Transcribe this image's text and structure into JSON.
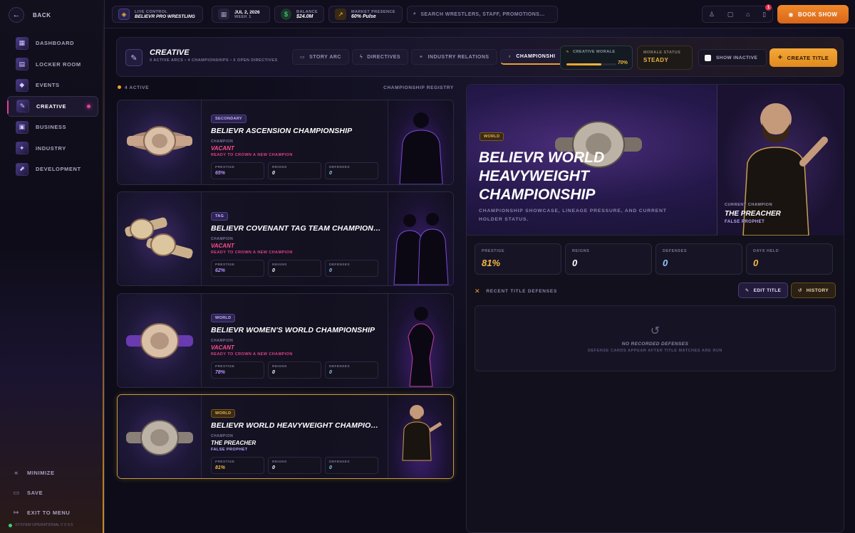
{
  "nav": {
    "back_label": "BACK",
    "items": [
      {
        "label": "DASHBOARD",
        "icon": "dashboard-icon",
        "active": false
      },
      {
        "label": "LOCKER ROOM",
        "icon": "locker-room-icon",
        "active": false
      },
      {
        "label": "EVENTS",
        "icon": "events-icon",
        "active": false
      },
      {
        "label": "CREATIVE",
        "icon": "creative-icon",
        "active": true
      },
      {
        "label": "BUSINESS",
        "icon": "business-icon",
        "active": false
      },
      {
        "label": "INDUSTRY",
        "icon": "industry-icon",
        "active": false
      },
      {
        "label": "DEVELOPMENT",
        "icon": "development-icon",
        "active": false
      }
    ],
    "minimize_label": "MINIMIZE",
    "save_label": "SAVE",
    "exit_label": "EXIT TO MENU",
    "status_label": "SYSTEM OPERATIONAL // V 0.5"
  },
  "topbar": {
    "live_label": "LIVE CONTROL",
    "promotion": "BELIEVR PRO WRESTLING",
    "date": "JUL 2, 2026",
    "week": "WEEK 1",
    "balance_label": "BALANCE",
    "balance": "$24.0M",
    "presence_label": "MARKET PRESENCE",
    "presence": "60% Pulse",
    "search_placeholder": "SEARCH WRESTLERS, STAFF, PROMOTIONS...",
    "notification_count": "1",
    "book_show_label": "BOOK SHOW"
  },
  "header": {
    "title": "CREATIVE",
    "subtitle": "0 ACTIVE ARCS • 4 CHAMPIONSHIPS • 0 OPEN DIRECTIVES",
    "tabs": [
      {
        "label": "STORY ARC",
        "icon": "book-icon"
      },
      {
        "label": "DIRECTIVES",
        "icon": "bolt-icon"
      },
      {
        "label": "INDUSTRY RELATIONS",
        "icon": "handshake-icon"
      },
      {
        "label": "CHAMPIONSHI",
        "icon": "medal-icon"
      }
    ],
    "morale_label": "CREATIVE MORALE",
    "morale_value": "70%",
    "morale_fraction": 0.7,
    "status_label": "MORALE STATUS",
    "status_value": "STEADY",
    "show_inactive_label": "SHOW INACTIVE",
    "create_label": "CREATE TITLE"
  },
  "list": {
    "count_label": "4 ACTIVE",
    "registry_label": "CHAMPIONSHIP REGISTRY",
    "champion_label": "CHAMPION",
    "prestige_label": "PRESTIGE",
    "reigns_label": "REIGNS",
    "defenses_label": "DEFENSES"
  },
  "cards": [
    {
      "tag": "SECONDARY",
      "tag_style": "purple",
      "name": "BELIEVR ASCENSION CHAMPIONSHIP",
      "champion": "VACANT",
      "sub": "READY TO CROWN A NEW CHAMPION",
      "vacant": true,
      "prestige": "65%",
      "reigns": "0",
      "defenses": "0",
      "selected": false
    },
    {
      "tag": "TAG",
      "tag_style": "purple",
      "name": "BELIEVR COVENANT TAG TEAM CHAMPIONS...",
      "champion": "VACANT",
      "sub": "READY TO CROWN A NEW CHAMPION",
      "vacant": true,
      "prestige": "62%",
      "reigns": "0",
      "defenses": "0",
      "selected": false
    },
    {
      "tag": "WORLD",
      "tag_style": "purple",
      "name": "BELIEVR WOMEN'S WORLD CHAMPIONSHIP",
      "champion": "VACANT",
      "sub": "READY TO CROWN A NEW CHAMPION",
      "vacant": true,
      "prestige": "78%",
      "reigns": "0",
      "defenses": "0",
      "selected": false
    },
    {
      "tag": "WORLD",
      "tag_style": "gold",
      "name": "BELIEVR WORLD HEAVYWEIGHT CHAMPION...",
      "champion": "THE PREACHER",
      "sub": "FALSE PROPHET",
      "vacant": false,
      "prestige": "81%",
      "reigns": "0",
      "defenses": "0",
      "selected": true
    }
  ],
  "detail": {
    "tag": "WORLD",
    "title": "BELIEVR WORLD HEAVYWEIGHT CHAMPIONSHIP",
    "description": "CHAMPIONSHIP SHOWCASE, LINEAGE PRESSURE, AND CURRENT HOLDER STATUS.",
    "current_label": "CURRENT CHAMPION",
    "champion": "THE PREACHER",
    "champion_sub": "FALSE PROPHET",
    "stats": [
      {
        "label": "PRESTIGE",
        "value": "81%"
      },
      {
        "label": "REIGNS",
        "value": "0"
      },
      {
        "label": "DEFENSES",
        "value": "0"
      },
      {
        "label": "DAYS HELD",
        "value": "0"
      }
    ],
    "defenses_label": "RECENT TITLE DEFENSES",
    "edit_label": "EDIT TITLE",
    "history_label": "HISTORY",
    "empty_title": "NO RECORDED DEFENSES",
    "empty_sub": "DEFENSE CARDS APPEAR AFTER TITLE MATCHES ARE RUN"
  }
}
